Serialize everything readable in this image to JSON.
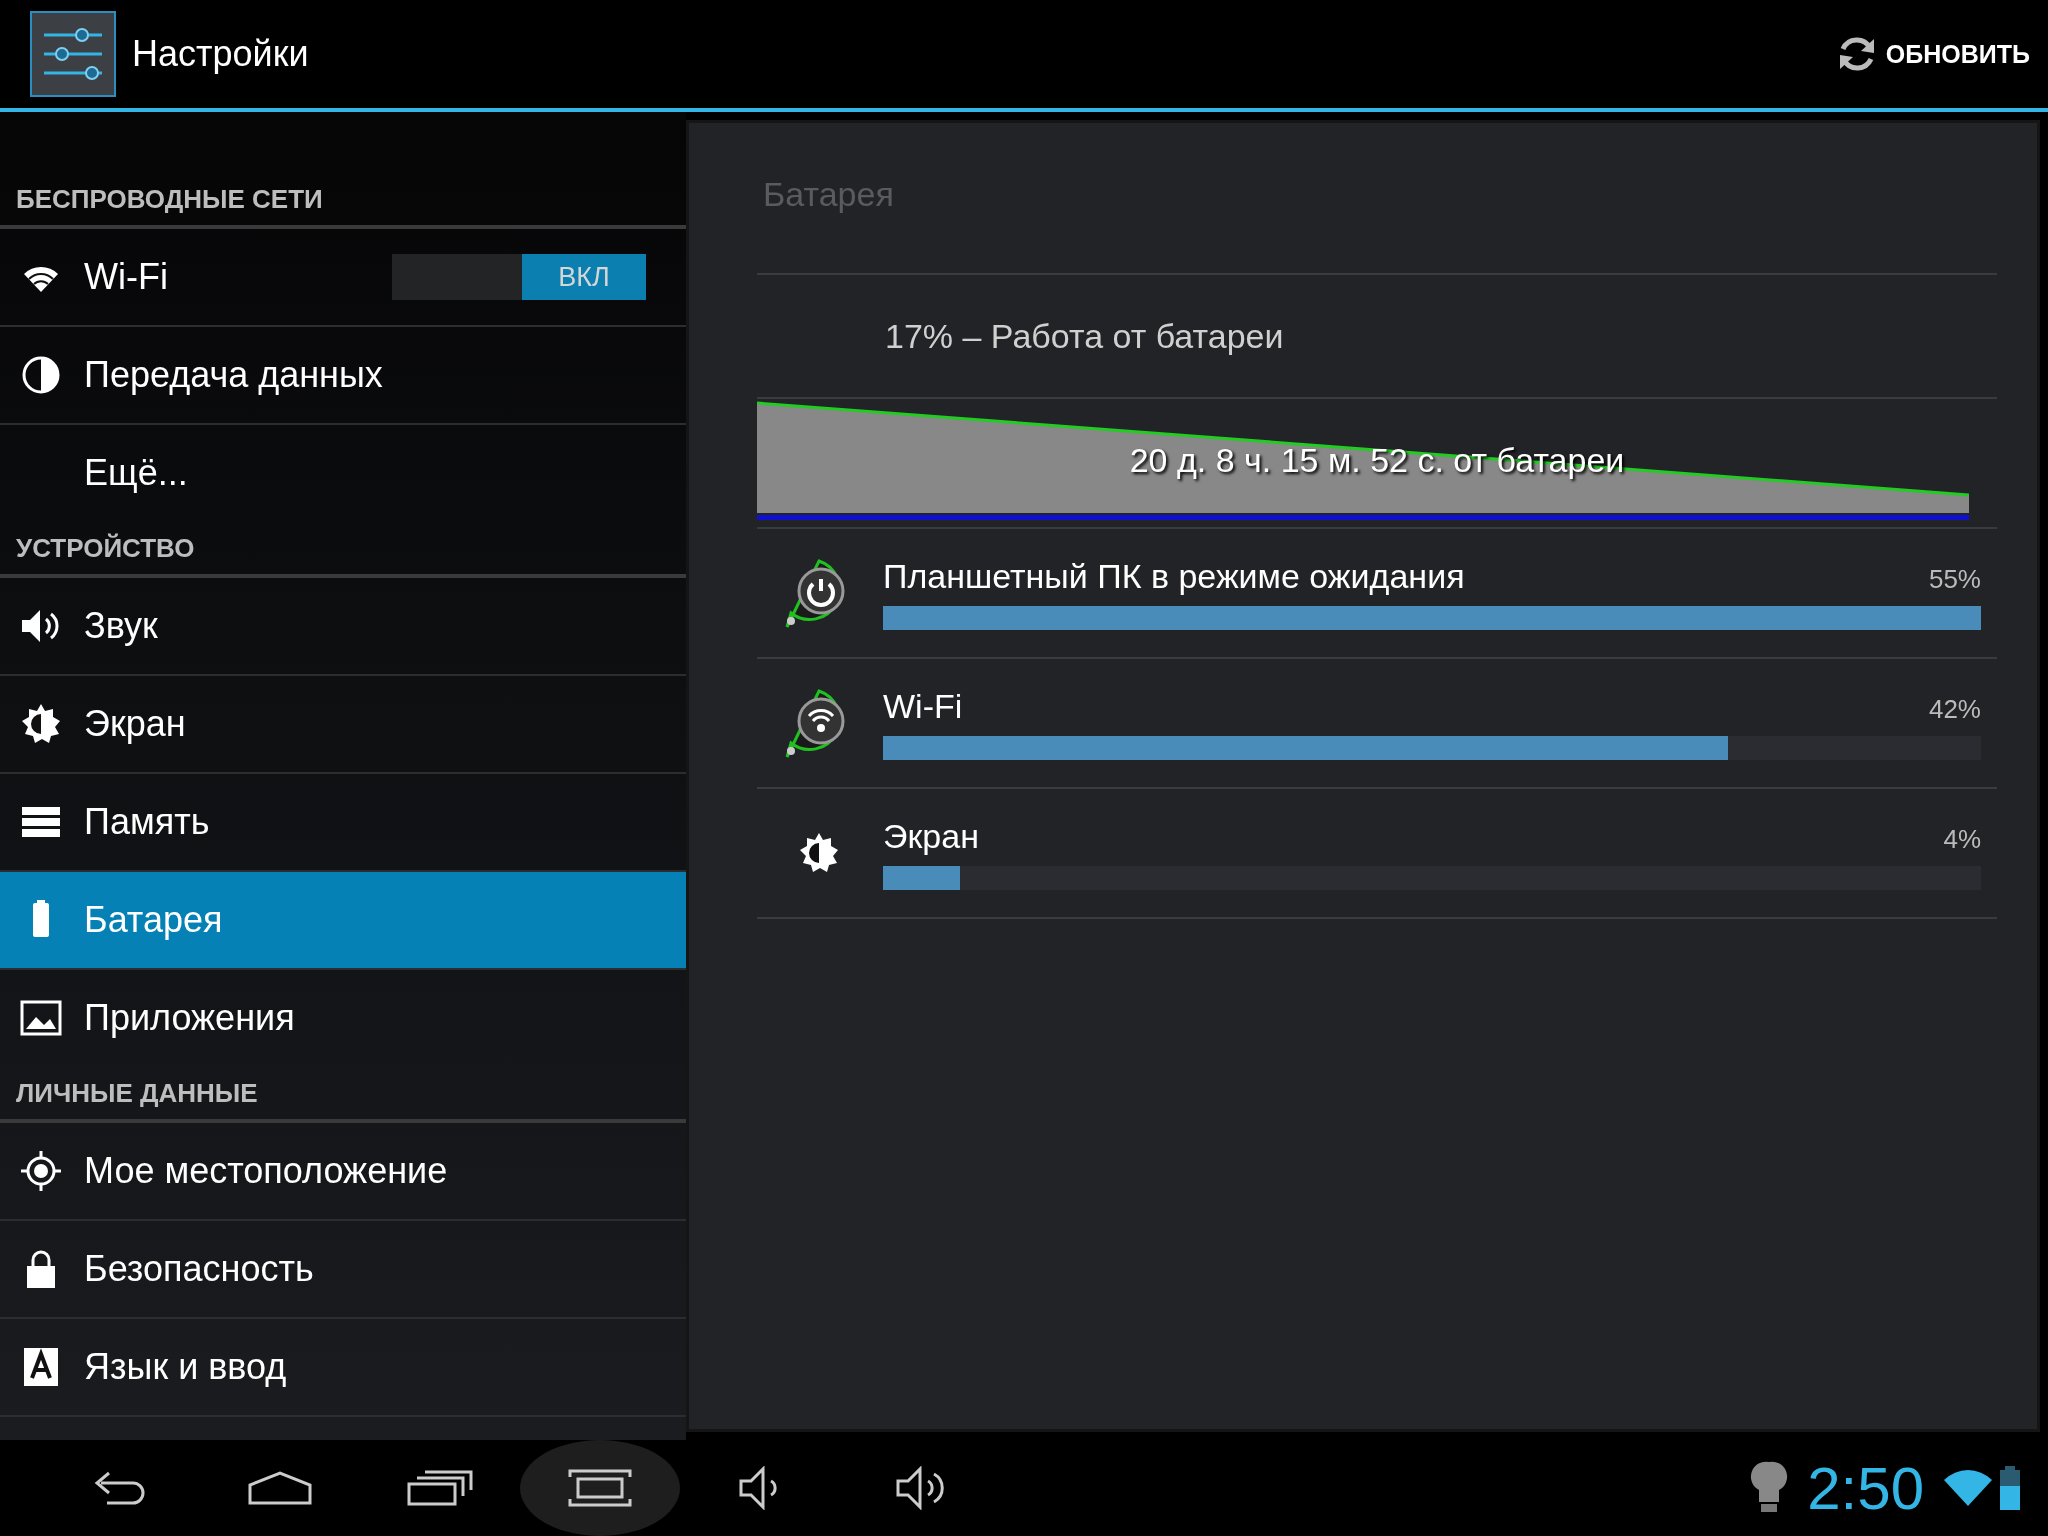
{
  "action_bar": {
    "title": "Настройки",
    "refresh_label": "ОБНОВИТЬ"
  },
  "sidebar": {
    "sections": [
      {
        "header": "БЕСПРОВОДНЫЕ СЕТИ",
        "items": [
          {
            "kind": "wifi",
            "label": "Wi-Fi",
            "selected": false,
            "toggle": {
              "label": "ВКЛ",
              "on": true
            }
          },
          {
            "kind": "data",
            "label": "Передача данных",
            "selected": false
          },
          {
            "kind": "none",
            "label": "Ещё...",
            "selected": false
          }
        ]
      },
      {
        "header": "УСТРОЙСТВО",
        "items": [
          {
            "kind": "sound",
            "label": "Звук",
            "selected": false
          },
          {
            "kind": "display",
            "label": "Экран",
            "selected": false
          },
          {
            "kind": "storage",
            "label": "Память",
            "selected": false
          },
          {
            "kind": "battery",
            "label": "Батарея",
            "selected": true
          },
          {
            "kind": "apps",
            "label": "Приложения",
            "selected": false
          }
        ]
      },
      {
        "header": "ЛИЧНЫЕ ДАННЫЕ",
        "items": [
          {
            "kind": "location",
            "label": "Мое местоположение",
            "selected": false
          },
          {
            "kind": "lock",
            "label": "Безопасность",
            "selected": false
          },
          {
            "kind": "language",
            "label": "Язык и ввод",
            "selected": false
          }
        ]
      }
    ]
  },
  "battery_panel": {
    "title": "Батарея",
    "status": "17% – Работа от батареи",
    "graph_label": "20 д. 8 ч. 15 м. 52 с. от батареи",
    "usage": [
      {
        "kind": "power",
        "name": "Планшетный ПК в режиме ожидания",
        "percent": "55%",
        "level": 1.0
      },
      {
        "kind": "wifi",
        "name": "Wi-Fi",
        "percent": "42%",
        "level": 0.77
      },
      {
        "kind": "display",
        "name": "Экран",
        "percent": "4%",
        "level": 0.07
      }
    ]
  },
  "nav_bar": {
    "buttons": [
      {
        "kind": "back",
        "pressed": false
      },
      {
        "kind": "home",
        "pressed": false
      },
      {
        "kind": "recents",
        "pressed": false
      },
      {
        "kind": "screenshot",
        "pressed": true
      },
      {
        "kind": "volume_down",
        "pressed": false
      },
      {
        "kind": "volume_up",
        "pressed": false
      }
    ],
    "time": "2:50"
  }
}
